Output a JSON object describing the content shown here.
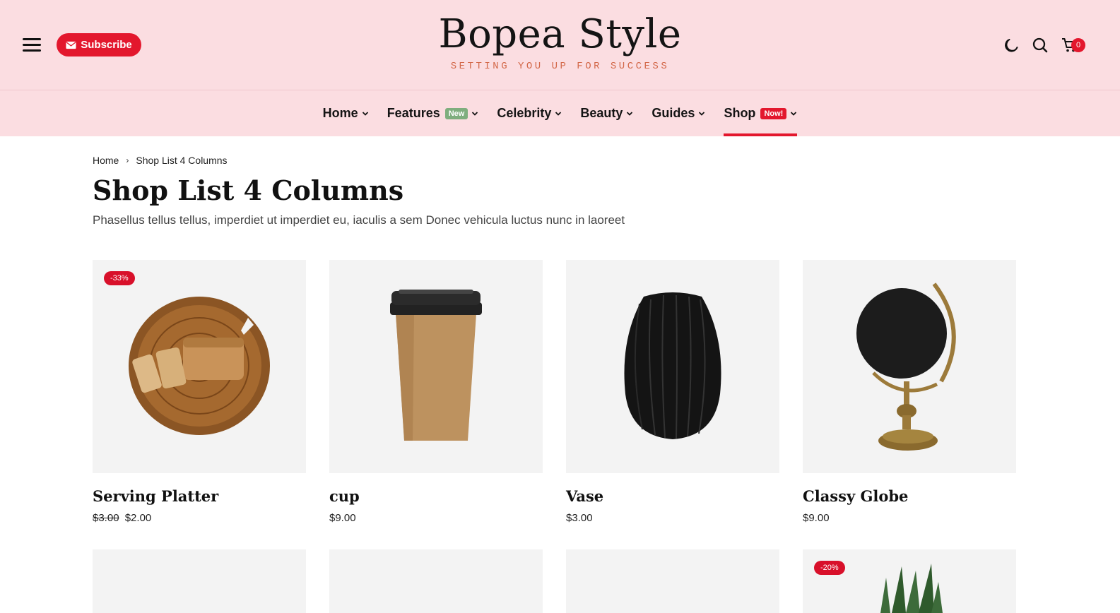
{
  "header": {
    "subscribe_label": "Subscribe",
    "brand_title": "Bopea Style",
    "brand_tagline": "SETTING YOU UP FOR SUCCESS",
    "cart_count": "0"
  },
  "nav": {
    "items": [
      {
        "label": "Home"
      },
      {
        "label": "Features",
        "badge": "New"
      },
      {
        "label": "Celebrity"
      },
      {
        "label": "Beauty"
      },
      {
        "label": "Guides"
      },
      {
        "label": "Shop",
        "badge": "Now!"
      }
    ],
    "active": "Shop"
  },
  "breadcrumb": {
    "home": "Home",
    "current": "Shop List 4 Columns"
  },
  "page": {
    "title": "Shop List 4 Columns",
    "description": "Phasellus tellus tellus, imperdiet ut imperdiet eu, iaculis a sem Donec vehicula luctus nunc in laoreet"
  },
  "products": [
    {
      "name": "Serving Platter",
      "old_price": "$3.00",
      "price": "$2.00",
      "sale": "-33%",
      "image": "wood-board-bread"
    },
    {
      "name": "cup",
      "price": "$9.00",
      "image": "paper-coffee-cup"
    },
    {
      "name": "Vase",
      "price": "$3.00",
      "image": "black-ribbed-vase"
    },
    {
      "name": "Classy Globe",
      "price": "$9.00",
      "image": "black-globe"
    }
  ],
  "products_row2": [
    {
      "image": "empty"
    },
    {
      "image": "empty"
    },
    {
      "image": "empty"
    },
    {
      "sale": "-20%",
      "image": "plant"
    }
  ],
  "colors": {
    "header_bg": "#fbdde1",
    "accent": "#e3172d",
    "tagline": "#d3694a",
    "badge_new": "#7fae7e"
  }
}
